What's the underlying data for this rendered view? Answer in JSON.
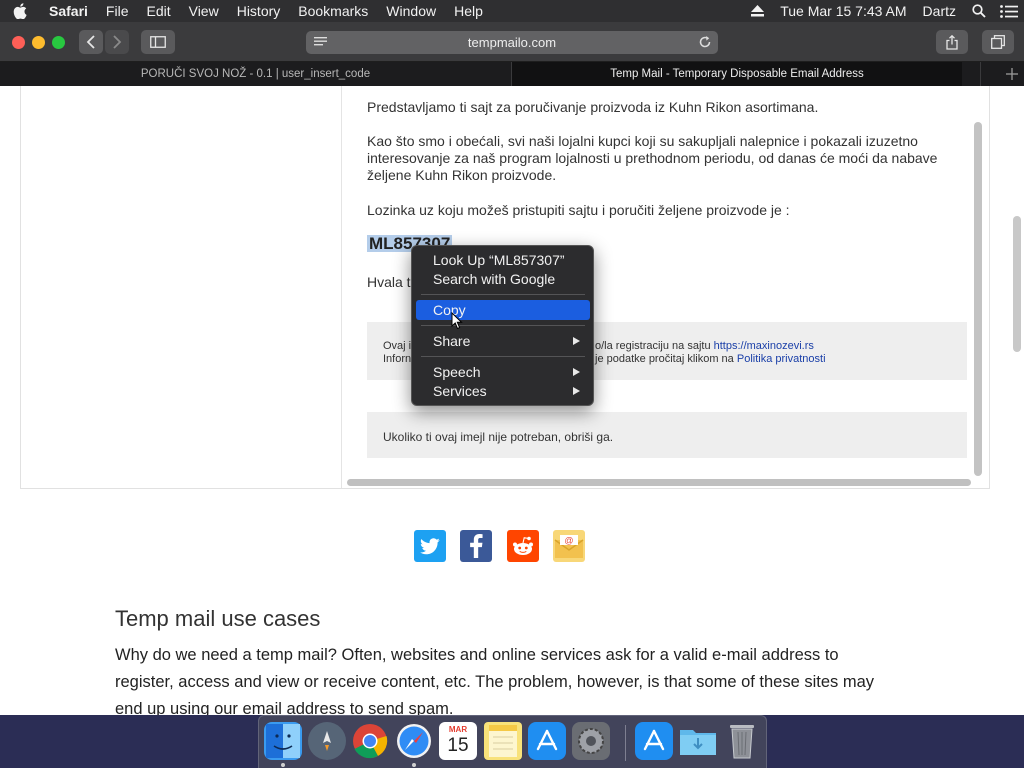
{
  "menubar": {
    "app": "Safari",
    "items": [
      "File",
      "Edit",
      "View",
      "History",
      "Bookmarks",
      "Window",
      "Help"
    ],
    "datetime": "Tue Mar 15  7:43 AM",
    "user": "Dartz"
  },
  "toolbar": {
    "url": "tempmailo.com"
  },
  "tabs": [
    {
      "title": "PORUČI SVOJ NOŽ - 0.1 | user_insert_code",
      "active": false
    },
    {
      "title": "Temp Mail - Temporary Disposable Email Address",
      "active": true
    }
  ],
  "email": {
    "intro": "Predstavljamo ti sajt za poručivanje proizvoda iz Kuhn Rikon asortimana.",
    "loyalty": "Kao što smo i obećali, svi naši lojalni kupci koji su sakupljali nalepnice i pokazali izuzetno interesovanje za naš program lojalnosti u prethodnom periodu, od danas će moći da nabave željene Kuhn Rikon proizvode.",
    "password_line": "Lozinka uz koju možeš pristupiti sajtu i poručiti željene proizvode je :",
    "code": "ML857307",
    "thanks_partial": "Hvala t",
    "footer_line1_start": "Ovaj i",
    "footer_line1_end": "o/la registraciju na sajtu",
    "footer_link": "https://maxinozevi.rs",
    "footer_line2_start": "Inforn",
    "footer_line2_end": "je podatke pročitaj klikom na",
    "privacy_link": "Politika privatnosti",
    "unsubscribe": "Ukoliko ti ovaj imejl nije potreban, obriši ga."
  },
  "context_menu": {
    "look_up": "Look Up “ML857307”",
    "search": "Search with Google",
    "copy": "Copy",
    "share": "Share",
    "speech": "Speech",
    "services": "Services"
  },
  "section": {
    "heading": "Temp mail use cases",
    "text": "Why do we need a temp mail? Often, websites and online services ask for a valid e-mail address to register, access and view or receive content, etc. The problem, however, is that some of these sites may end up using our email address to send spam."
  },
  "dock": {
    "calendar_month": "MAR",
    "calendar_day": "15"
  },
  "colors": {
    "highlight": "#1b5ee0",
    "selection": "#b4cdea",
    "twitter": "#1da1f2",
    "facebook": "#3b5998",
    "reddit": "#ff4500"
  }
}
